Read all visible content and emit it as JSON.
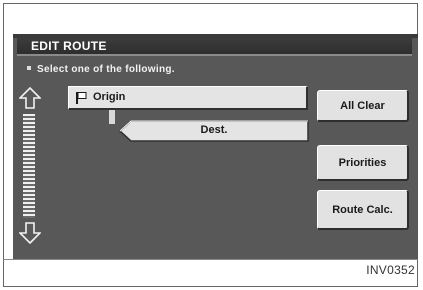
{
  "header": {
    "title": "EDIT ROUTE"
  },
  "instruction": "Select one of the following.",
  "route": {
    "origin": {
      "label": "Origin",
      "icon": "flag-icon"
    },
    "destination": {
      "label": "Dest."
    }
  },
  "buttons": {
    "all_clear": "All Clear",
    "priorities": "Priorities",
    "route_calc": "Route Calc."
  },
  "scroll": {
    "up_icon": "up-arrow-icon",
    "down_icon": "down-arrow-icon"
  },
  "image_code": "INV0352",
  "colors": {
    "screen_bg": "#585858",
    "button_face": "#e2e2e2",
    "header_bg": "#2e2e2e"
  }
}
